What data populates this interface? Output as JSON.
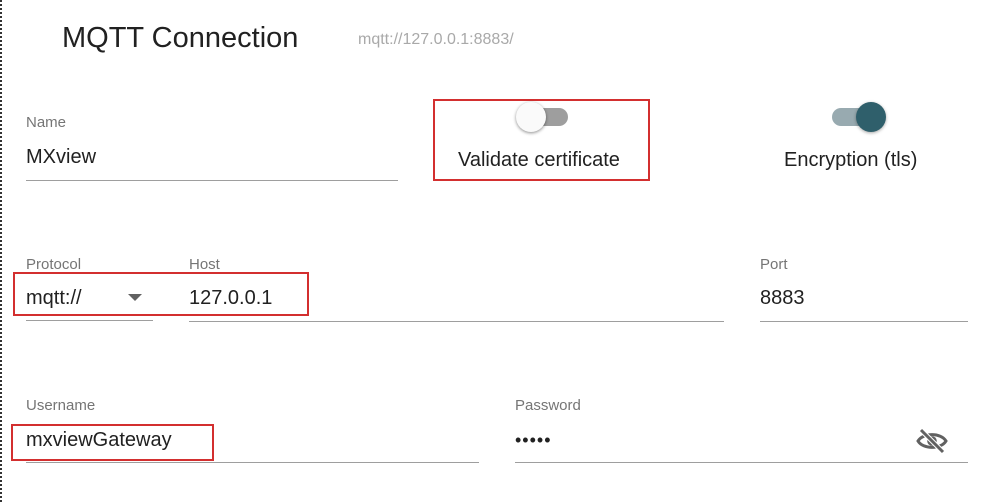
{
  "header": {
    "title": "MQTT Connection",
    "url": "mqtt://127.0.0.1:8883/"
  },
  "form": {
    "name": {
      "label": "Name",
      "value": "MXview"
    },
    "validate_certificate": {
      "label": "Validate certificate",
      "checked": false
    },
    "encryption": {
      "label": "Encryption (tls)",
      "checked": true
    },
    "protocol": {
      "label": "Protocol",
      "value": "mqtt://"
    },
    "host": {
      "label": "Host",
      "value": "127.0.0.1"
    },
    "port": {
      "label": "Port",
      "value": "8883"
    },
    "username": {
      "label": "Username",
      "value": "mxviewGateway"
    },
    "password": {
      "label": "Password",
      "value": "•••••"
    }
  },
  "icons": {
    "dropdown": "chevron-down-icon",
    "visibility": "eye-off-icon"
  },
  "colors": {
    "highlight": "#d32f2f",
    "toggle_on_thumb": "#2f5f6b",
    "toggle_on_track": "#98aab0",
    "toggle_off_track": "#9e9e9e",
    "toggle_off_thumb": "#fafafa"
  }
}
